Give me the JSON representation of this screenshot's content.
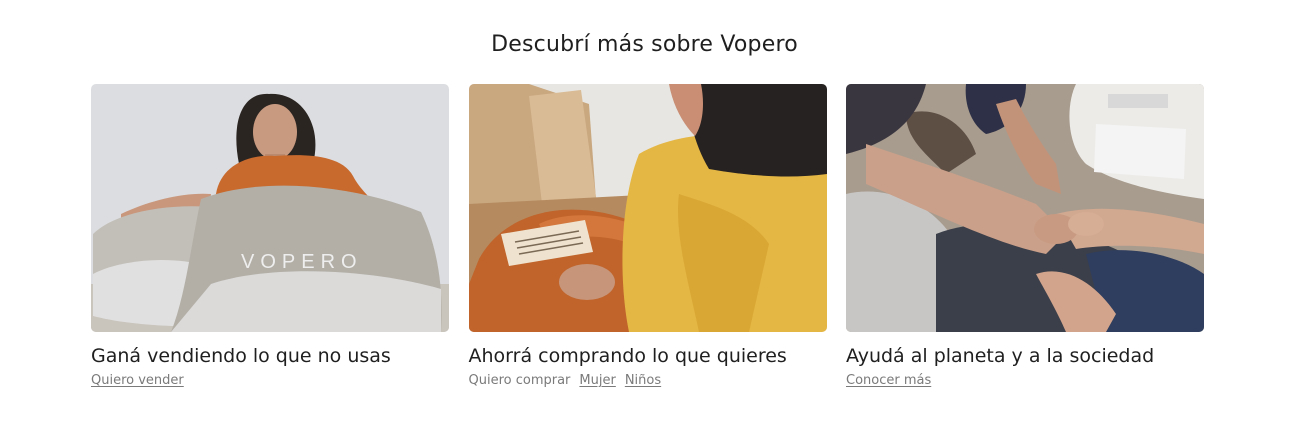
{
  "section": {
    "title": "Descubrí más sobre Vopero"
  },
  "cards": [
    {
      "image_alt": "Mujer con bolsas Vopero",
      "bag_text": "VOPERO",
      "title": "Ganá vendiendo lo que no usas",
      "links": [
        {
          "label": "Quiero vender",
          "underlined": true
        }
      ]
    },
    {
      "image_alt": "Mujer abriendo una caja con ropa",
      "title": "Ahorrá comprando lo que quieres",
      "links": [
        {
          "label": "Quiero comprar",
          "underlined": false
        },
        {
          "label": "Mujer",
          "underlined": true
        },
        {
          "label": "Niños",
          "underlined": true
        }
      ]
    },
    {
      "image_alt": "Manos sobre ropa",
      "title": "Ayudá al planeta y a la sociedad",
      "links": [
        {
          "label": "Conocer más",
          "underlined": true
        }
      ]
    }
  ],
  "colors": {
    "title_text": "#1f1f1f",
    "link_text": "#7a7a7a",
    "background": "#ffffff"
  }
}
